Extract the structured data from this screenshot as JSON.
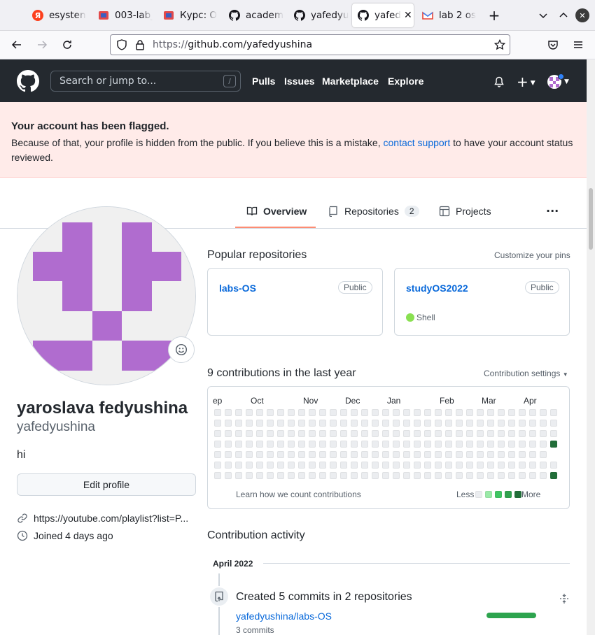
{
  "browser": {
    "tabs": [
      {
        "title": "esysten",
        "icon": "yandex-icon"
      },
      {
        "title": "003-lab_",
        "icon": "course-icon"
      },
      {
        "title": "Курс: О",
        "icon": "course-icon"
      },
      {
        "title": "academ",
        "icon": "github-icon"
      },
      {
        "title": "yafedyu",
        "icon": "github-icon"
      },
      {
        "title": "yafed",
        "icon": "github-icon",
        "active": true
      },
      {
        "title": "lab 2 os",
        "icon": "gmail-icon"
      }
    ],
    "url_prefix": "https://",
    "url_host": "github.com/yafedyushina"
  },
  "header": {
    "search_placeholder": "Search or jump to...",
    "slash_key": "/",
    "nav": [
      "Pulls",
      "Issues",
      "Marketplace",
      "Explore"
    ]
  },
  "flash": {
    "heading": "Your account has been flagged.",
    "body_before": "Because of that, your profile is hidden from the public. If you believe this is a mistake, ",
    "link": "contact support",
    "body_after": " to have your account status reviewed."
  },
  "tabs": {
    "overview": "Overview",
    "repositories": "Repositories",
    "repositories_count": "2",
    "projects": "Projects",
    "more": "···"
  },
  "profile": {
    "name": "yaroslava fedyushina",
    "login": "yafedyushina",
    "bio": "hi",
    "edit_button": "Edit profile",
    "link": "https://youtube.com/playlist?list=P...",
    "joined": "Joined 4 days ago",
    "avatar_color": "#b06ccf"
  },
  "popular": {
    "title": "Popular repositories",
    "customize": "Customize your pins",
    "repos": [
      {
        "name": "labs-OS",
        "visibility": "Public",
        "language": ""
      },
      {
        "name": "studyOS2022",
        "visibility": "Public",
        "language": "Shell",
        "language_color": "#89e051"
      }
    ]
  },
  "contributions": {
    "title": "9 contributions in the last year",
    "settings": "Contribution settings",
    "months": [
      "ep",
      "Oct",
      "Nov",
      "Dec",
      "Jan",
      "Feb",
      "Mar",
      "Apr"
    ],
    "learn": "Learn how we count contributions",
    "less": "Less",
    "more": "More",
    "legend_colors": [
      "#ebedf0",
      "#9be9a8",
      "#40c463",
      "#30a14e",
      "#216e39"
    ]
  },
  "activity": {
    "title": "Contribution activity",
    "month": "April 2022",
    "summary": "Created 5 commits in 2 repositories",
    "repo": "yafedyushina/labs-OS",
    "commits": "3 commits"
  }
}
